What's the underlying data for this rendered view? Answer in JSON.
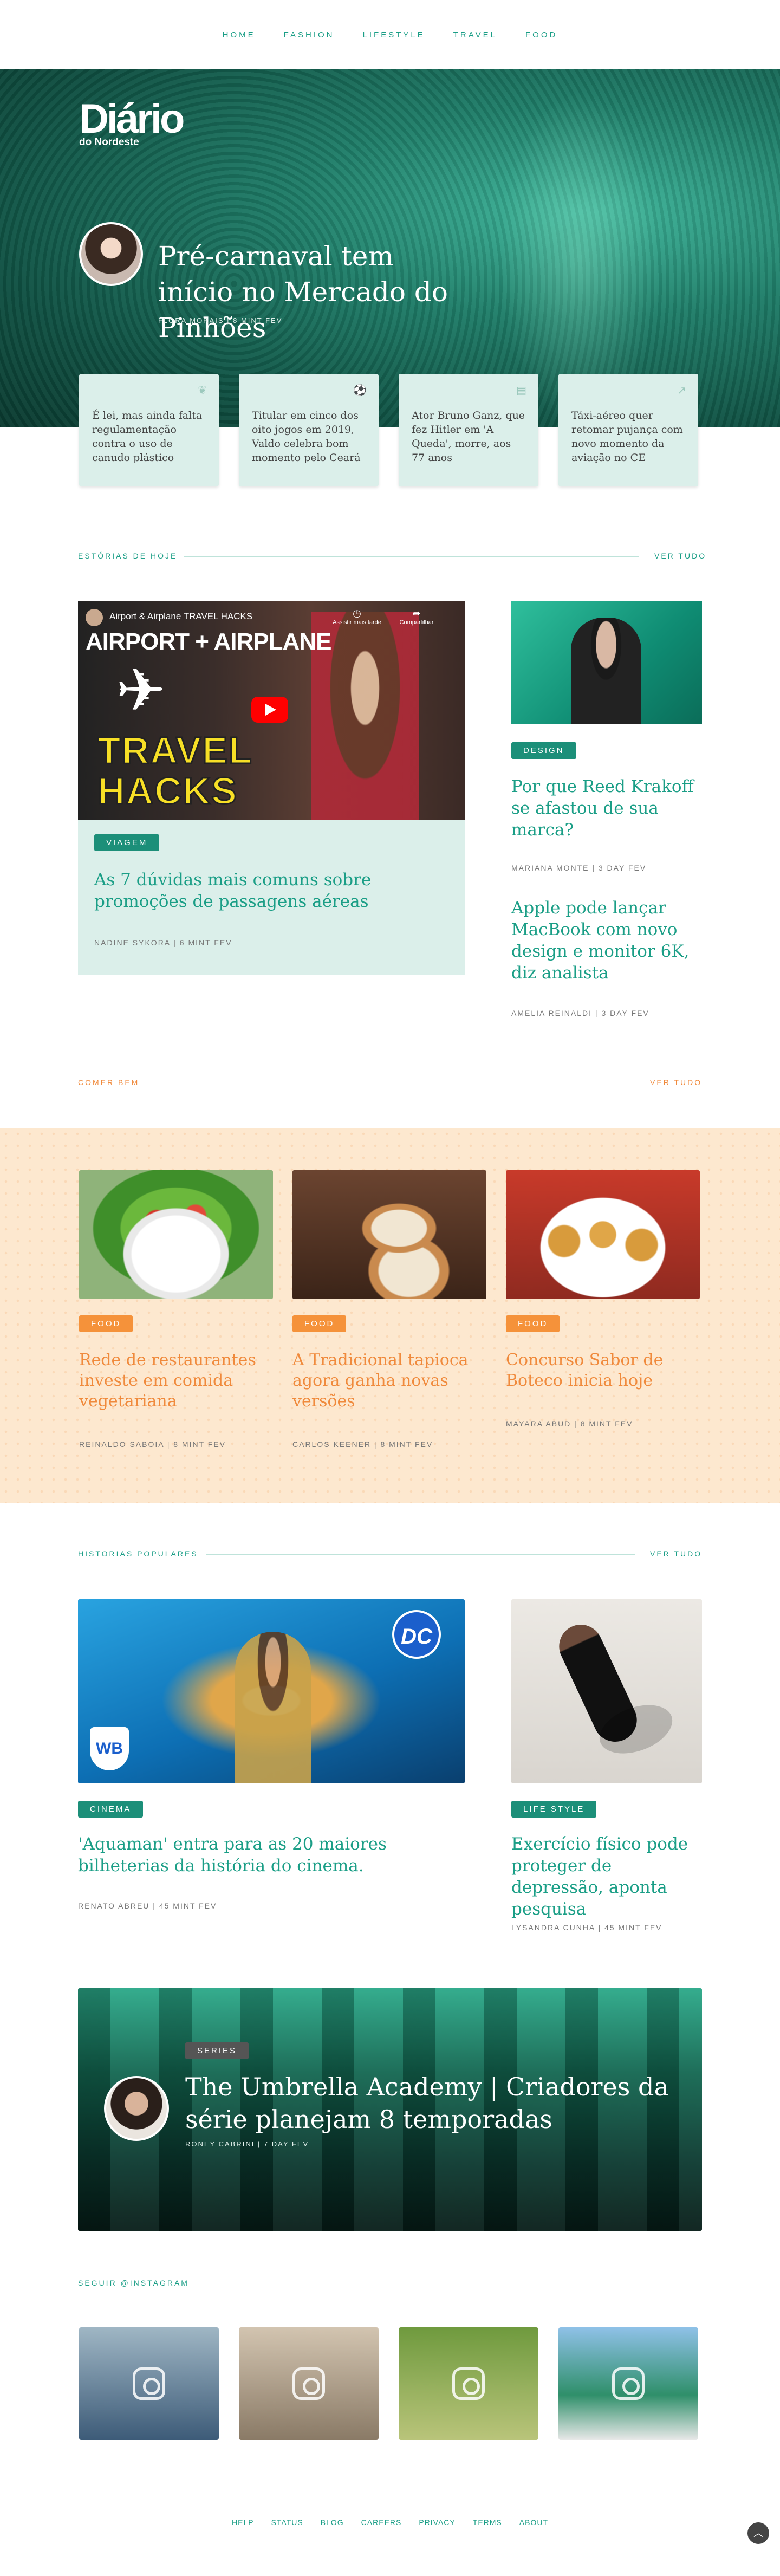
{
  "nav": [
    "HOME",
    "FASHION",
    "LIFESTYLE",
    "TRAVEL",
    "FOOD"
  ],
  "brand": {
    "name": "Diário",
    "sub": "do Nordeste"
  },
  "hero": {
    "title": "Pré-carnaval tem início no Mercado do Pinhões",
    "meta": "FLORA MORAIS  |  8 MINT FEV"
  },
  "hero_cards": [
    {
      "text": "É lei, mas ainda falta regulamentação contra o uso de canudo plástico",
      "icon": "leaf-icon"
    },
    {
      "text": "Titular em cinco dos oito jogos em 2019, Valdo celebra bom momento pelo Ceará",
      "icon": "soccer-ball-icon"
    },
    {
      "text": "Ator Bruno Ganz, que fez Hitler em 'A Queda', morre, aos 77 anos",
      "icon": "newspaper-icon"
    },
    {
      "text": "Táxi-aéreo quer retomar pujança com novo momento da aviação no CE",
      "icon": "chart-line-icon"
    }
  ],
  "today": {
    "heading": "ESTÓRIAS DE HOJE",
    "see_all": "VER TUDO",
    "video": {
      "title": "Airport & Airplane TRAVEL HACKS",
      "watch_later": "Assistir mais tarde",
      "share": "Compartilhar",
      "line1": "AIRPORT + AIRPLANE",
      "line2": "TRAVEL",
      "line3": "HACKS"
    },
    "main": {
      "tag": "VIAGEM",
      "title": "As 7 dúvidas mais comuns sobre promoções de passagens aéreas",
      "meta": "NADINE SYKORA  |  6 MINT FEV"
    },
    "side1": {
      "tag": "DESIGN",
      "title": "Por que Reed Krakoff se afastou de sua marca?",
      "meta": "MARIANA MONTE  |  3 DAY FEV"
    },
    "side2": {
      "title": "Apple pode lançar MacBook com novo design e monitor 6K, diz analista",
      "meta": "AMELIA REINALDI  |  3 DAY FEV"
    }
  },
  "food": {
    "heading": "COMER BEM",
    "see_all": "VER TUDO",
    "items": [
      {
        "tag": "FOOD",
        "title": "Rede de restaurantes investe em comida vegetariana",
        "meta": "REINALDO SABOIA  |  8 MINT FEV"
      },
      {
        "tag": "FOOD",
        "title": "A Tradicional tapioca agora ganha novas versões",
        "meta": "CARLOS KEENER  |  8 MINT FEV"
      },
      {
        "tag": "FOOD",
        "title": "Concurso Sabor de Boteco inicia hoje",
        "meta": "MAYARA ABUD  |  8 MINT FEV"
      }
    ]
  },
  "popular": {
    "heading": "HISTORIAS POPULARES",
    "see_all": "VER TUDO",
    "main": {
      "tag": "CINEMA",
      "title": "'Aquaman' entra para as 20 maiores bilheterias da história do cinema.",
      "meta": "RENATO ABREU  |  45 MINT FEV"
    },
    "side": {
      "tag": "LIFE STYLE",
      "title": "Exercício físico pode proteger de depressão, aponta pesquisa",
      "meta": "LYSANDRA CUNHA  |  45 MINT FEV"
    },
    "logos": {
      "dc": "DC",
      "wb": "WB"
    }
  },
  "feature": {
    "tag": "SERIES",
    "title": "The Umbrella Academy | Criadores da série planejam 8 temporadas",
    "meta": "RONEY CABRINI  |  7 DAY FEV"
  },
  "instagram": {
    "heading": "SEGUIR @INSTAGRAM"
  },
  "footer": [
    "HELP",
    "STATUS",
    "BLOG",
    "CAREERS",
    "PRIVACY",
    "TERMS",
    "ABOUT"
  ],
  "colors": {
    "accent": "#1a9e86",
    "orange": "#f5923a",
    "mint": "#dbefea",
    "peach": "#fde8cf"
  }
}
